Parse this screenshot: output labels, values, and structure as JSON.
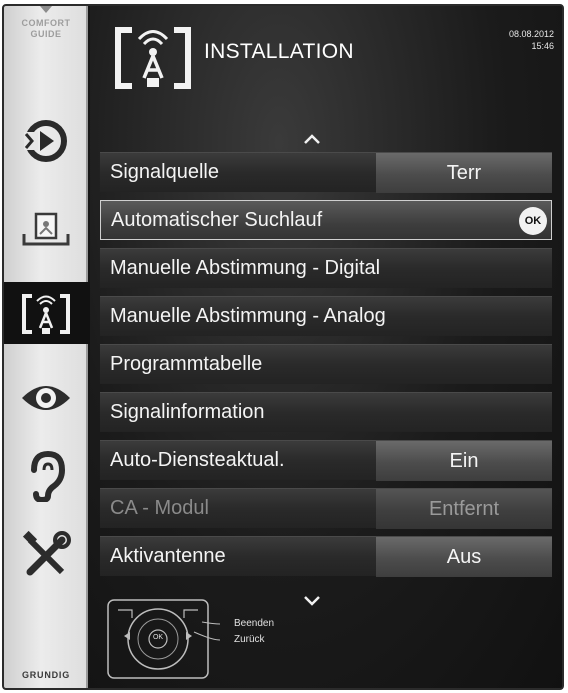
{
  "sidebar": {
    "comfort_guide_line1": "COMFORT",
    "comfort_guide_line2": "GUIDE",
    "items": [
      {
        "name": "source-icon"
      },
      {
        "name": "picture-icon"
      },
      {
        "name": "installation-icon",
        "active": true
      },
      {
        "name": "eye-icon"
      },
      {
        "name": "ear-icon"
      },
      {
        "name": "tools-icon"
      }
    ],
    "brand": "GRUNDIG"
  },
  "header": {
    "title": "INSTALLATION",
    "date": "08.08.2012",
    "time": "15:46"
  },
  "menu": [
    {
      "label": "Signalquelle",
      "value": "Terr"
    },
    {
      "label": "Automatischer Suchlauf",
      "ok": "OK"
    },
    {
      "label": "Manuelle Abstimmung - Digital"
    },
    {
      "label": "Manuelle Abstimmung - Analog"
    },
    {
      "label": "Programmtabelle"
    },
    {
      "label": "Signalinformation"
    },
    {
      "label": "Auto-Diensteaktual.",
      "value": "Ein"
    },
    {
      "label": "CA - Modul",
      "value": "Entfernt"
    },
    {
      "label": "Aktivantenne",
      "value": "Aus"
    }
  ],
  "footer": {
    "ok": "OK",
    "exit_label": "Beenden",
    "back_label": "Zurück"
  },
  "colors": {
    "background": "#151515",
    "sidebar": "#e6e6e6",
    "row": "#2a2a2a",
    "value_cell": "#555555",
    "text": "#f4f4f4",
    "disabled_text": "#8a8a8a"
  }
}
